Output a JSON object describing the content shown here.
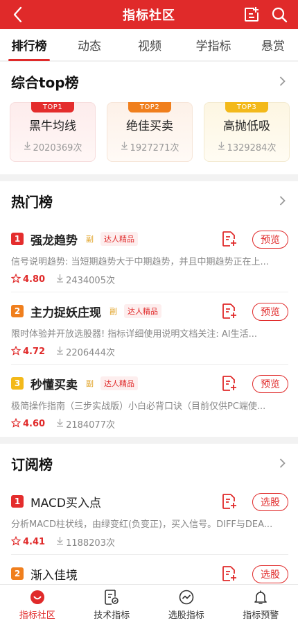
{
  "header": {
    "title": "指标社区"
  },
  "tabs": [
    {
      "label": "排行榜",
      "active": true
    },
    {
      "label": "动态"
    },
    {
      "label": "视频"
    },
    {
      "label": "学指标"
    },
    {
      "label": "悬赏"
    }
  ],
  "top_section": {
    "title": "综合top榜",
    "cards": [
      {
        "badge": "TOP1",
        "name": "黑牛均线",
        "count": "2020369次"
      },
      {
        "badge": "TOP2",
        "name": "绝佳买卖",
        "count": "1927271次"
      },
      {
        "badge": "TOP3",
        "name": "高抛低吸",
        "count": "1329284次"
      }
    ]
  },
  "hot_section": {
    "title": "热门榜",
    "items": [
      {
        "rank": "1",
        "name": "强龙趋势",
        "sub": "副",
        "tag": "达人精品",
        "action": "预览",
        "desc": "信号说明趋势: 当短期趋势大于中期趋势，并且中期趋势正在上...",
        "rating": "4.80",
        "downloads": "2434005次"
      },
      {
        "rank": "2",
        "name": "主力捉妖庄现",
        "sub": "副",
        "tag": "达人精品",
        "action": "预览",
        "desc": "限时体验并开放选股器! 指标详细使用说明文档关注: AI生活...",
        "rating": "4.72",
        "downloads": "2206444次"
      },
      {
        "rank": "3",
        "name": "秒懂买卖",
        "sub": "副",
        "tag": "达人精品",
        "action": "预览",
        "desc": "极简操作指南（三步实战版）小白必背口诀（目前仅供PC端使...",
        "rating": "4.60",
        "downloads": "2184077次"
      }
    ]
  },
  "sub_section": {
    "title": "订阅榜",
    "items": [
      {
        "rank": "1",
        "name": "MACD买入点",
        "action": "选股",
        "desc": "分析MACD柱状线，由绿变红(负变正)，买入信号。DIFF与DEA...",
        "rating": "4.41",
        "downloads": "1188203次"
      },
      {
        "rank": "2",
        "name": "渐入佳境",
        "action": "选股"
      }
    ]
  },
  "bottom_nav": [
    {
      "label": "指标社区",
      "icon": "community-icon",
      "active": true
    },
    {
      "label": "技术指标",
      "icon": "doc-icon"
    },
    {
      "label": "选股指标",
      "icon": "chart-icon"
    },
    {
      "label": "指标预警",
      "icon": "bell-icon"
    }
  ],
  "colors": {
    "brand": "#e02a2a",
    "top1": "#e42d2d",
    "top2": "#f07f1d",
    "top3": "#f3b91a"
  }
}
